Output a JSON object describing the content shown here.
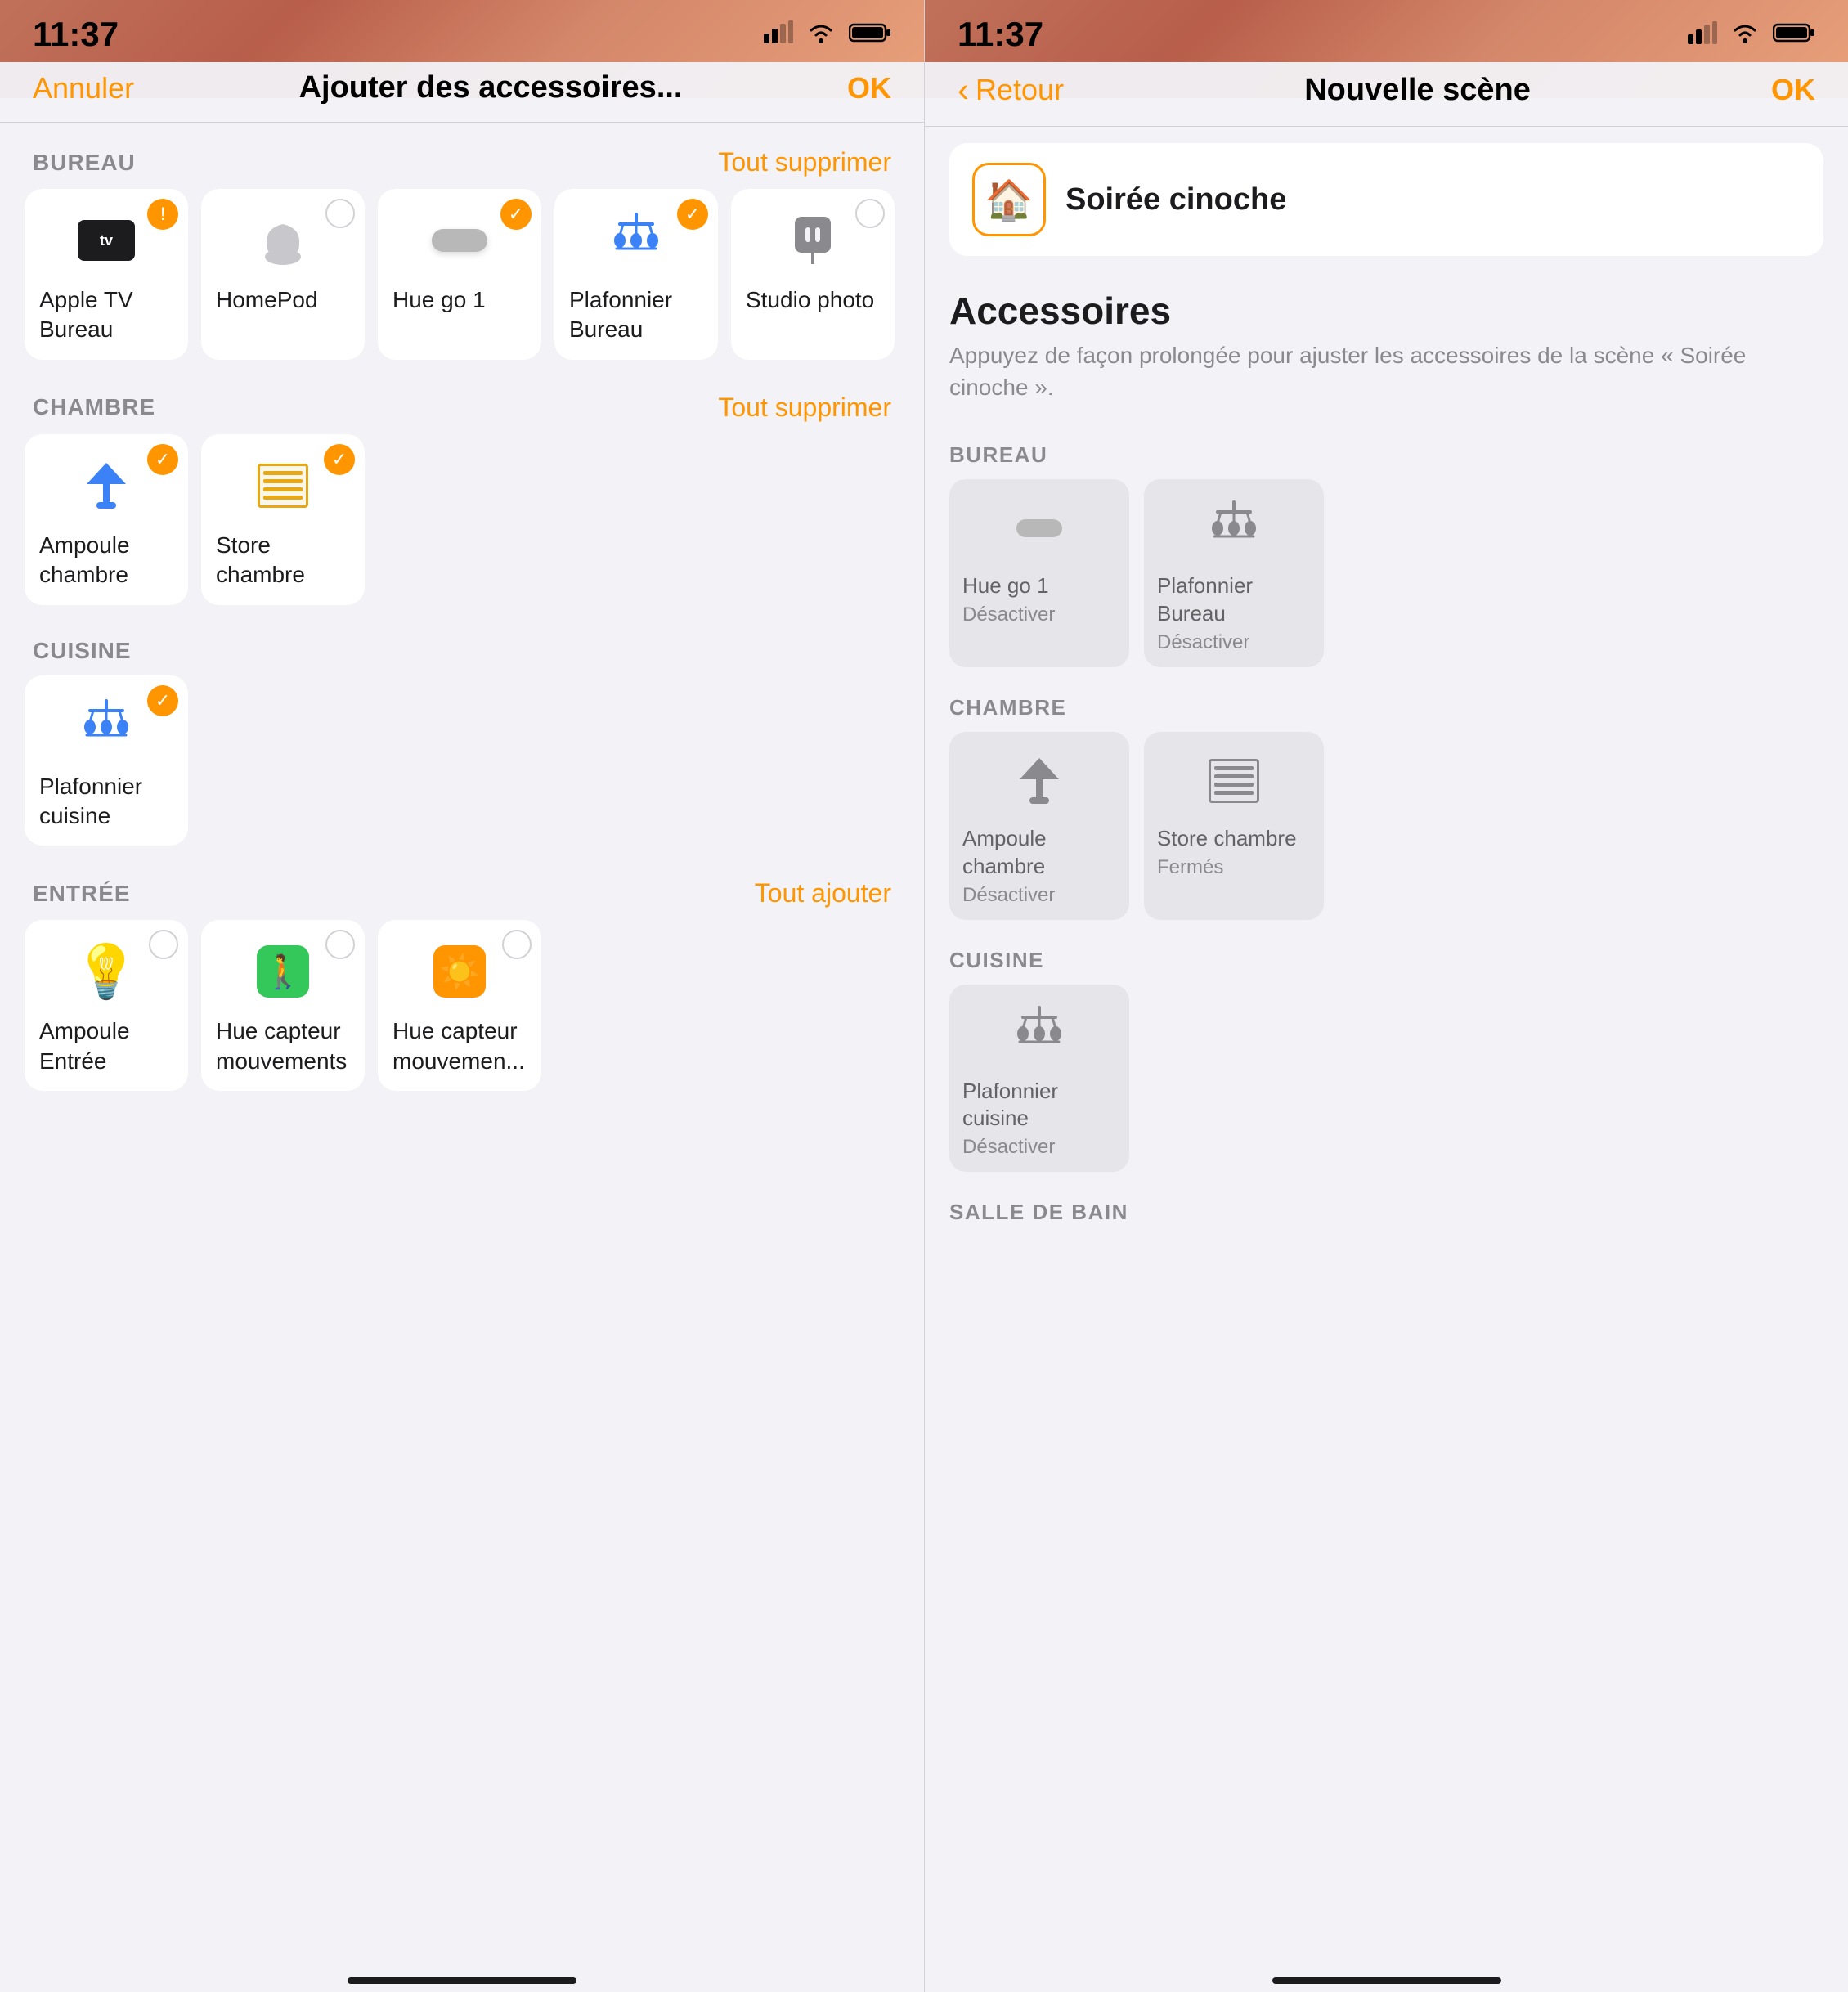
{
  "left": {
    "statusBar": {
      "time": "11:37",
      "signal": "▪▪▪",
      "wifi": "wifi",
      "battery": "battery"
    },
    "navBar": {
      "cancel": "Annuler",
      "title": "Ajouter des accessoires...",
      "ok": "OK"
    },
    "sections": [
      {
        "id": "bureau",
        "title": "BUREAU",
        "action": "Tout supprimer",
        "accessories": [
          {
            "id": "apple-tv",
            "label": "Apple TV Bureau",
            "icon": "appletv",
            "badge": "warning",
            "badgeSymbol": "!"
          },
          {
            "id": "homepod",
            "label": "HomePod",
            "icon": "homepod",
            "badge": "unselected"
          },
          {
            "id": "hue-go-1",
            "label": "Hue go 1",
            "icon": "hue-go",
            "badge": "selected",
            "badgeSymbol": "✓"
          },
          {
            "id": "plafonnier-bureau",
            "label": "Plafonnier Bureau",
            "icon": "chandelier-blue",
            "badge": "selected",
            "badgeSymbol": "✓"
          },
          {
            "id": "studio-photo",
            "label": "Studio photo",
            "icon": "plug",
            "badge": "unselected"
          }
        ]
      },
      {
        "id": "chambre",
        "title": "CHAMBRE",
        "action": "Tout supprimer",
        "accessories": [
          {
            "id": "ampoule-chambre",
            "label": "Ampoule chambre",
            "icon": "lamp-blue",
            "badge": "selected",
            "badgeSymbol": "✓"
          },
          {
            "id": "store-chambre",
            "label": "Store chambre",
            "icon": "blind-yellow",
            "badge": "selected",
            "badgeSymbol": "✓"
          }
        ]
      },
      {
        "id": "cuisine",
        "title": "CUISINE",
        "action": null,
        "accessories": [
          {
            "id": "plafonnier-cuisine",
            "label": "Plafonnier cuisine",
            "icon": "chandelier-blue",
            "badge": "selected",
            "badgeSymbol": "✓"
          }
        ]
      },
      {
        "id": "entree",
        "title": "ENTRÉE",
        "action": "Tout ajouter",
        "accessories": [
          {
            "id": "ampoule-entree",
            "label": "Ampoule Entrée",
            "icon": "bulb",
            "badge": "unselected"
          },
          {
            "id": "hue-capteur-mouvements",
            "label": "Hue capteur mouvements",
            "icon": "motion",
            "badge": "unselected"
          },
          {
            "id": "hue-capteur-mouvemen2",
            "label": "Hue capteur mouvemen...",
            "icon": "sun",
            "badge": "unselected"
          }
        ]
      }
    ]
  },
  "right": {
    "statusBar": {
      "time": "11:37"
    },
    "navBar": {
      "back": "Retour",
      "title": "Nouvelle scène",
      "ok": "OK"
    },
    "sceneName": "Soirée cinoche",
    "sceneIcon": "🏠",
    "accessoriesTitle": "Accessoires",
    "accessoriesDesc": "Appuyez de façon prolongée pour ajuster les accessoires de la scène « Soirée cinoche ».",
    "sections": [
      {
        "id": "bureau",
        "title": "BUREAU",
        "accessories": [
          {
            "id": "hue-go-1",
            "label": "Hue go 1",
            "status": "Désactiver",
            "icon": "hue-go-gray"
          },
          {
            "id": "plafonnier-bureau",
            "label": "Plafonnier Bureau",
            "status": "Désactiver",
            "icon": "chandelier-gray"
          }
        ]
      },
      {
        "id": "chambre",
        "title": "CHAMBRE",
        "accessories": [
          {
            "id": "ampoule-chambre",
            "label": "Ampoule chambre",
            "status": "Désactiver",
            "icon": "lamp-gray"
          },
          {
            "id": "store-chambre",
            "label": "Store chambre",
            "status": "Fermés",
            "icon": "blind-gray"
          }
        ]
      },
      {
        "id": "cuisine",
        "title": "CUISINE",
        "accessories": [
          {
            "id": "plafonnier-cuisine",
            "label": "Plafonnier cuisine",
            "status": "Désactiver",
            "icon": "chandelier-gray"
          }
        ]
      },
      {
        "id": "salle-de-bain",
        "title": "SALLE DE BAIN",
        "accessories": []
      }
    ]
  }
}
